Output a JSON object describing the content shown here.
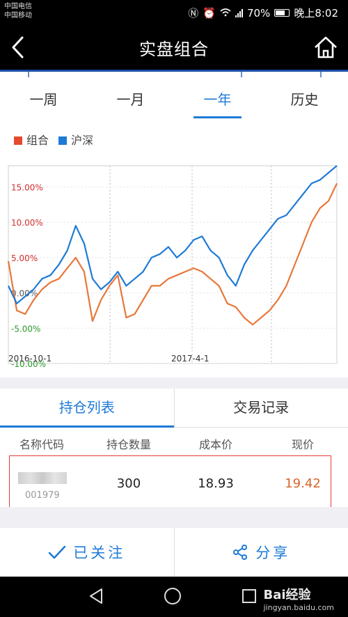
{
  "status": {
    "carrier1": "中国电信",
    "carrier2": "中国移动",
    "battery": "70%",
    "time": "晚上8:02"
  },
  "header": {
    "title": "实盘组合",
    "back_icon": "back-arrow-icon",
    "home_icon": "home-icon"
  },
  "period_tabs": [
    {
      "label": "一周",
      "active": false
    },
    {
      "label": "一月",
      "active": false
    },
    {
      "label": "一年",
      "active": true
    },
    {
      "label": "历史",
      "active": false
    }
  ],
  "legend": [
    {
      "label": "组合",
      "color": "#e64a2e"
    },
    {
      "label": "沪深",
      "color": "#1e7ad6"
    }
  ],
  "chart_data": {
    "type": "line",
    "x_ticks": [
      "2016-10-1",
      "2017-4-1"
    ],
    "y_ticks": [
      "15.00%",
      "10.00%",
      "5.00%",
      "0.00%",
      "-5.00%",
      "-10.00%"
    ],
    "ylim": [
      -10,
      18
    ],
    "series": [
      {
        "name": "组合",
        "color": "#e8773a",
        "values": [
          4.5,
          -2.5,
          -3.0,
          -1.0,
          0.5,
          1.5,
          2.0,
          3.5,
          5.0,
          3.0,
          -4.0,
          -1.0,
          1.0,
          2.5,
          -3.5,
          -3.0,
          -1.0,
          1.0,
          1.0,
          2.0,
          2.5,
          3.0,
          3.5,
          3.0,
          2.0,
          1.0,
          -1.5,
          -2.0,
          -3.5,
          -4.5,
          -3.5,
          -2.5,
          -1.0,
          1.0,
          4.0,
          7.0,
          10.0,
          12.0,
          13.0,
          15.5
        ]
      },
      {
        "name": "沪深",
        "color": "#1e7ad6",
        "values": [
          1.0,
          -1.5,
          -0.5,
          0.5,
          2.0,
          2.5,
          4.0,
          6.0,
          9.5,
          7.0,
          2.0,
          0.5,
          1.5,
          3.0,
          1.0,
          2.0,
          3.0,
          5.0,
          5.5,
          6.5,
          5.0,
          6.0,
          7.5,
          8.0,
          6.0,
          5.0,
          2.5,
          1.0,
          4.0,
          6.0,
          7.5,
          9.0,
          10.5,
          11.0,
          12.5,
          14.0,
          15.5,
          16.0,
          17.0,
          18.0
        ]
      }
    ]
  },
  "holdings_tabs": [
    {
      "label": "持仓列表",
      "active": true
    },
    {
      "label": "交易记录",
      "active": false
    }
  ],
  "table": {
    "headers": [
      "名称代码",
      "持仓数量",
      "成本价",
      "现价"
    ],
    "rows": [
      {
        "code": "001979",
        "quantity": "300",
        "cost": "18.93",
        "price": "19.42"
      }
    ]
  },
  "actions": {
    "follow_label": "已关注",
    "share_label": "分享"
  },
  "watermark": {
    "brand": "Bai经验",
    "url": "jingyan.baidu.com"
  }
}
